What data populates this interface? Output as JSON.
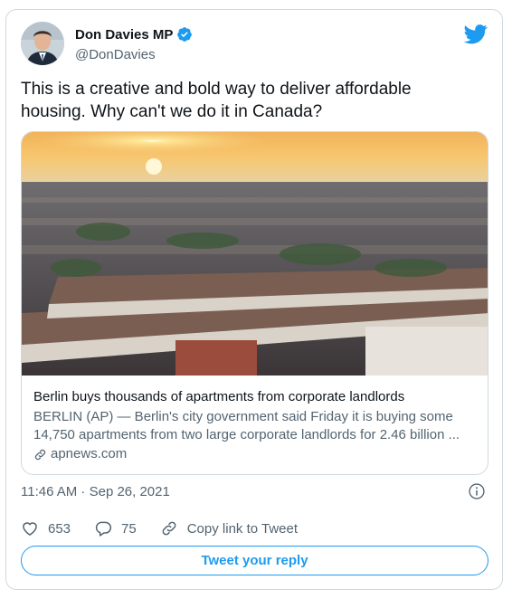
{
  "author": {
    "name": "Don Davies MP",
    "handle": "@DonDavies",
    "verified": true
  },
  "tweet": {
    "text": "This is a creative and bold way to deliver affordable housing. Why can't we do it in Canada?"
  },
  "link_card": {
    "title": "Berlin buys thousands of apartments from corporate landlords",
    "description": "BERLIN (AP) — Berlin's city government said Friday it is buying some 14,750 apartments from two large corporate landlords for 2.46 billion ...",
    "domain": "apnews.com",
    "image_subject": "sunset over Berlin apartment blocks"
  },
  "timestamp": "11:46 AM · Sep 26, 2021",
  "actions": {
    "likes": "653",
    "replies": "75",
    "copy_link_label": "Copy link to Tweet"
  },
  "reply_button_label": "Tweet your reply",
  "colors": {
    "accent": "#1d9bf0",
    "text_primary": "#0f1419",
    "text_secondary": "#536471",
    "border": "#cfd9de"
  },
  "icons": [
    "verified-badge-icon",
    "twitter-bird-icon",
    "link-icon",
    "info-icon",
    "heart-icon",
    "reply-bubble-icon",
    "copy-link-icon"
  ]
}
